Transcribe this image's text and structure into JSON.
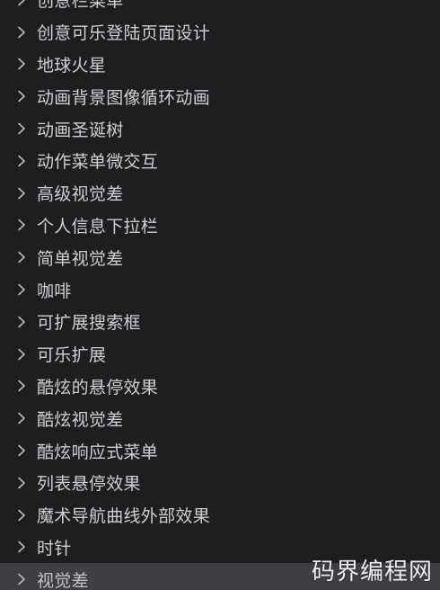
{
  "explorer": {
    "items": [
      {
        "label": "创意栏菜单"
      },
      {
        "label": "创意可乐登陆页面设计"
      },
      {
        "label": "地球火星"
      },
      {
        "label": "动画背景图像循环动画"
      },
      {
        "label": "动画圣诞树"
      },
      {
        "label": "动作菜单微交互"
      },
      {
        "label": "高级视觉差"
      },
      {
        "label": "个人信息下拉栏"
      },
      {
        "label": "简单视觉差"
      },
      {
        "label": "咖啡"
      },
      {
        "label": "可扩展搜索框"
      },
      {
        "label": "可乐扩展"
      },
      {
        "label": "酷炫的悬停效果"
      },
      {
        "label": "酷炫视觉差"
      },
      {
        "label": "酷炫响应式菜单"
      },
      {
        "label": "列表悬停效果"
      },
      {
        "label": "魔术导航曲线外部效果"
      },
      {
        "label": "时针"
      },
      {
        "label": "视觉差"
      }
    ],
    "selected_index": 18
  },
  "watermark": {
    "text": "码界编程网"
  },
  "colors": {
    "background": "#1e1e21",
    "selected_row": "#3e3f43",
    "text": "#cfcfd2",
    "chevron": "#bdbdc0"
  },
  "icons": {
    "row_toggle": "chevron-right-icon"
  }
}
